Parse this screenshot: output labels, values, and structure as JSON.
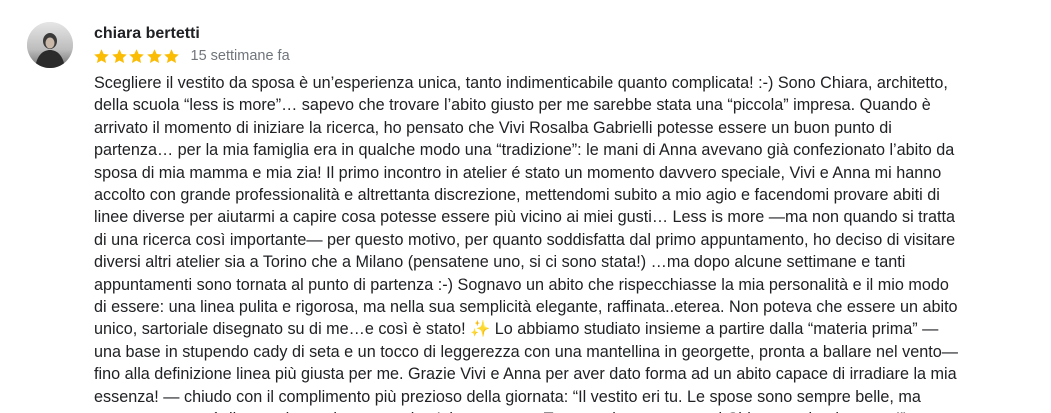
{
  "review": {
    "author": "chiara bertetti",
    "rating": 5,
    "rating_max": 5,
    "date": "15 settimane fa",
    "star_color": "#fbbc04",
    "avatar_icon": "profile-photo",
    "text": "Scegliere il vestito da sposa è un’esperienza unica, tanto indimenticabile quanto complicata! :-) Sono Chiara, architetto,\ndella scuola “less is more”… sapevo che trovare l’abito giusto per me sarebbe stata una “piccola” impresa. Quando è\narrivato il momento di iniziare la ricerca, ho pensato che Vivi Rosalba Gabrielli potesse essere un buon punto di\npartenza… per la mia famiglia era in qualche modo una “tradizione”: le mani di Anna avevano già confezionato l’abito da\nsposa di mia mamma e mia zia! Il primo incontro in atelier é stato un momento davvero speciale, Vivi e Anna mi hanno\naccolto con grande professionalità e altrettanta discrezione, mettendomi subito a mio agio e facendomi provare abiti di\nlinee diverse per aiutarmi a capire cosa potesse essere più vicino ai miei gusti… Less is more —ma non quando si tratta\ndi una ricerca così importante— per questo motivo, per quanto soddisfatta dal primo appuntamento, ho deciso di visitare\ndiversi altri atelier sia a Torino che a Milano (pensatene uno, si ci sono stata!) …ma dopo alcune settimane e tanti\nappuntamenti sono tornata al punto di partenza :-) Sognavo un abito che rispecchiasse la mia personalità e il mio modo\ndi essere: una linea pulita e rigorosa, ma nella sua semplicità elegante, raffinata..eterea. Non poteva che essere un abito\nunico, sartoriale disegnato su di me…e così è stato! ✨ Lo abbiamo studiato insieme a partire dalla “materia prima” —\nuna base in stupendo cady di seta e un tocco di leggerezza con una mantellina in georgette, pronta a ballare nel vento—\nfino alla definizione linea più giusta per me. Grazie Vivi e Anna per aver dato forma ad un abito capace di irradiare la mia\nessenza! — chiudo con il complimento più prezioso della giornata: “Il vestito eri tu. Le spose sono sempre belle, ma\nspesso sono così diverse da sembrare quasi un’altra persona. Tu non eri una sposa, eri Chiara vestita da sposa!”"
  }
}
